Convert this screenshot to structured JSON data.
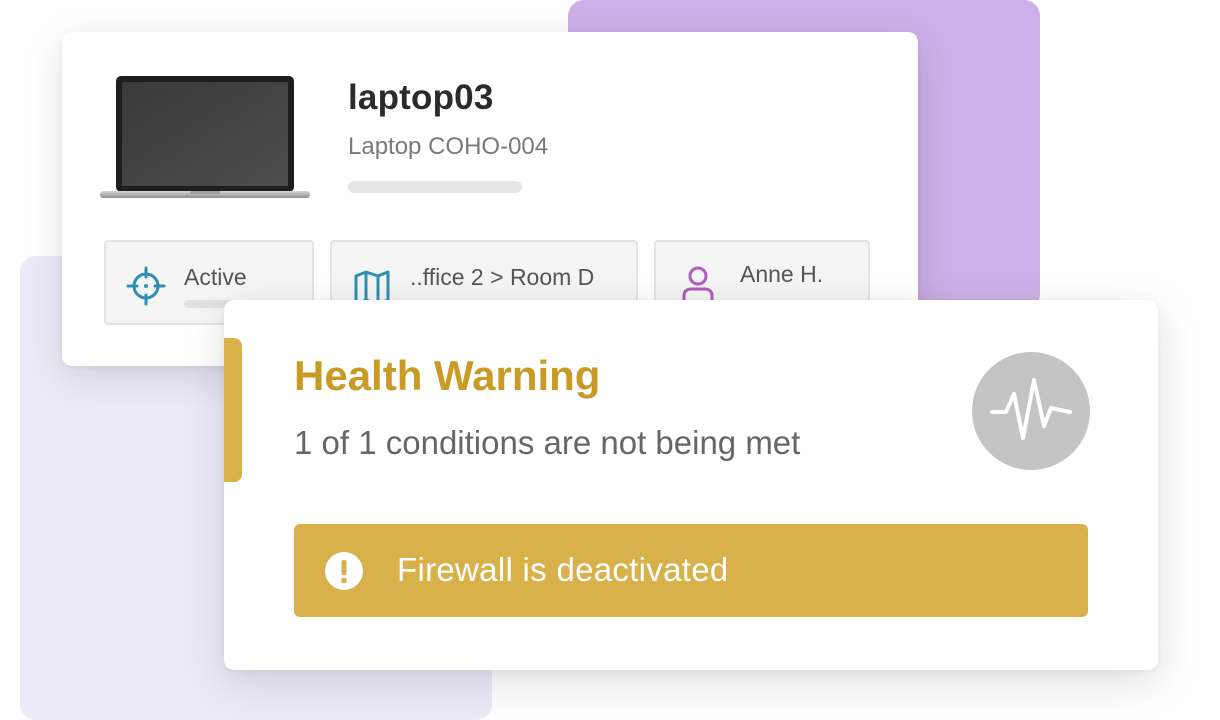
{
  "device": {
    "name": "laptop03",
    "model": "Laptop COHO-004",
    "image_icon": "laptop-icon",
    "chips": {
      "status": {
        "icon": "target-icon",
        "label": "Active",
        "color": "#2e8fb0"
      },
      "location": {
        "icon": "map-icon",
        "label": "..ffice 2 > Room D",
        "color": "#2e8fb0"
      },
      "user": {
        "icon": "user-icon",
        "label": "Anne H.",
        "color": "#b05cc0"
      }
    }
  },
  "health": {
    "title": "Health Warning",
    "description": "1 of 1 conditions are not being met",
    "status_icon": "pulse-icon",
    "alert": {
      "icon": "exclamation-icon",
      "message": "Firewall is deactivated"
    }
  },
  "colors": {
    "warning_accent": "#d9b14b",
    "warning_title": "#c99a24",
    "purple_panel": "#cdb0e9",
    "lavender_panel": "#edeaf8"
  }
}
